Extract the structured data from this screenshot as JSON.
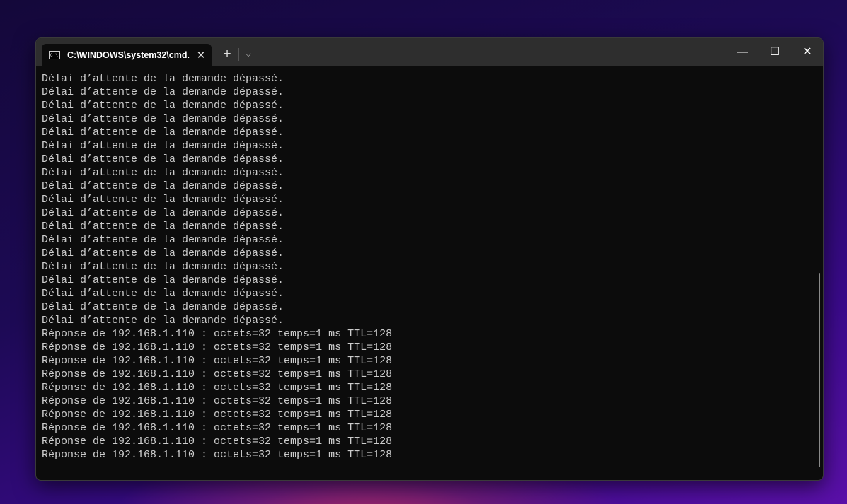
{
  "tab": {
    "title": "C:\\WINDOWS\\system32\\cmd.",
    "icon": "C:\\_",
    "close": "✕"
  },
  "toolbar": {
    "new_tab": "+",
    "dropdown": "⌵"
  },
  "window_controls": {
    "minimize": "—",
    "maximize": "☐",
    "close": "✕"
  },
  "lines": [
    "Délai d’attente de la demande dépassé.",
    "Délai d’attente de la demande dépassé.",
    "Délai d’attente de la demande dépassé.",
    "Délai d’attente de la demande dépassé.",
    "Délai d’attente de la demande dépassé.",
    "Délai d’attente de la demande dépassé.",
    "Délai d’attente de la demande dépassé.",
    "Délai d’attente de la demande dépassé.",
    "Délai d’attente de la demande dépassé.",
    "Délai d’attente de la demande dépassé.",
    "Délai d’attente de la demande dépassé.",
    "Délai d’attente de la demande dépassé.",
    "Délai d’attente de la demande dépassé.",
    "Délai d’attente de la demande dépassé.",
    "Délai d’attente de la demande dépassé.",
    "Délai d’attente de la demande dépassé.",
    "Délai d’attente de la demande dépassé.",
    "Délai d’attente de la demande dépassé.",
    "Délai d’attente de la demande dépassé.",
    "Réponse de 192.168.1.110 : octets=32 temps=1 ms TTL=128",
    "Réponse de 192.168.1.110 : octets=32 temps=1 ms TTL=128",
    "Réponse de 192.168.1.110 : octets=32 temps=1 ms TTL=128",
    "Réponse de 192.168.1.110 : octets=32 temps=1 ms TTL=128",
    "Réponse de 192.168.1.110 : octets=32 temps=1 ms TTL=128",
    "Réponse de 192.168.1.110 : octets=32 temps=1 ms TTL=128",
    "Réponse de 192.168.1.110 : octets=32 temps=1 ms TTL=128",
    "Réponse de 192.168.1.110 : octets=32 temps=1 ms TTL=128",
    "Réponse de 192.168.1.110 : octets=32 temps=1 ms TTL=128",
    "Réponse de 192.168.1.110 : octets=32 temps=1 ms TTL=128"
  ]
}
